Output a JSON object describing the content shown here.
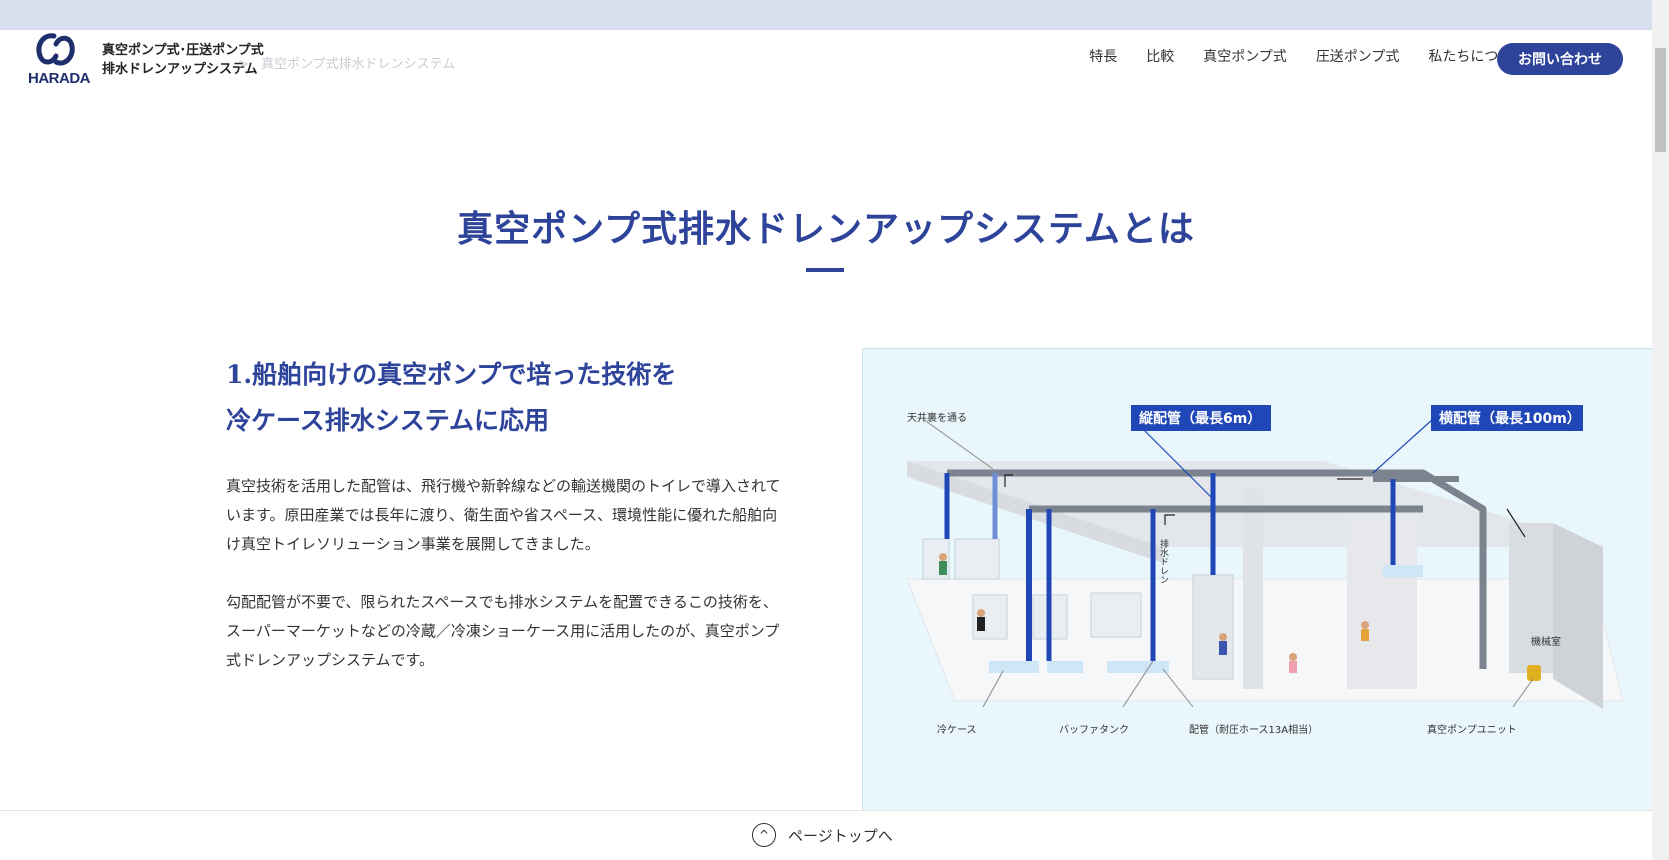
{
  "brand": {
    "logo_text": "HARADA",
    "line1": "真空ポンプ式･圧送ポンプ式",
    "line2": "排水ドレンアップシステム"
  },
  "breadcrumb": {
    "current": "真空ポンプ式排水ドレンシステム"
  },
  "nav": {
    "items": [
      "特長",
      "比較",
      "真空ポンプ式",
      "圧送ポンプ式",
      "私たちについて"
    ],
    "contact_label": "お問い合わせ"
  },
  "page": {
    "title": "真空ポンプ式排水ドレンアップシステムとは"
  },
  "section1": {
    "heading_line1": "1.船舶向けの真空ポンプで培った技術を",
    "heading_line2": "冷ケース排水システムに応用",
    "para1": "真空技術を活用した配管は、飛行機や新幹線などの輸送機関のトイレで導入されています。原田産業では長年に渡り、衛生面や省スペース、環境性能に優れた船舶向け真空トイレソリューション事業を展開してきました。",
    "para2": "勾配配管が不要で、限られたスペースでも排水システムを配置できるこの技術を、スーパーマーケットなどの冷蔵／冷凍ショーケース用に活用したのが、真空ポンプ式ドレンアップシステムです。"
  },
  "diagram": {
    "label_ceiling": "天井裏を通る",
    "label_vertical": "縦配管（最長6m）",
    "label_horizontal": "横配管（最長100m）",
    "label_drain": "排水ドレン",
    "label_machine_room": "機械室",
    "label_cold_case": "冷ケース",
    "label_buffer_tank": "バッファタンク",
    "label_pipe": "配管（耐圧ホース13A相当）",
    "label_pump_unit": "真空ポンプユニット",
    "colors": {
      "pipe_blue": "#1f47b8",
      "pipe_gray": "#7b838f",
      "callout": "#1f47b8"
    }
  },
  "footer": {
    "pagetop_label": "ページトップへ"
  }
}
